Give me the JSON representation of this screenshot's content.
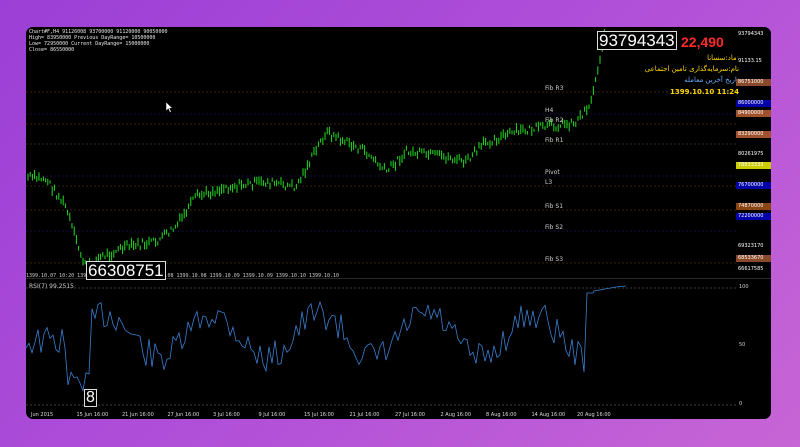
{
  "window": {
    "info_lines": [
      "Chart#F,H4  91126008 93700000 91120000 90050000",
      "High= 83950000 Previous DayRange= 10500000",
      "Low= 72950000 Current DayRange= 15000000",
      "Close= 86550000"
    ]
  },
  "price_readouts": {
    "high_box": "93794343",
    "low_box": "66308751",
    "rsi_box": "8",
    "change_value": "22,490"
  },
  "info_panel": {
    "line1": "نماد:سسانا",
    "line2": "نام:سرمایه‌گذاری تامین اجتماعی",
    "line3": "تاریخ آخرین معامله",
    "line4": "1399.10.10  11:24"
  },
  "levels": [
    {
      "label": "Fib R3"
    },
    {
      "label": "H4"
    },
    {
      "label": "Fib R2"
    },
    {
      "label": "Fib R1"
    },
    {
      "label": "Pivot"
    },
    {
      "label": "L3"
    },
    {
      "label": "Fib S1"
    },
    {
      "label": "Fib S2"
    },
    {
      "label": "Fib S3"
    }
  ],
  "price_axis": [
    {
      "text": "93794343",
      "bg": "#000000"
    },
    {
      "text": "91133.15",
      "bg": "#000000"
    },
    {
      "text": "86751000",
      "bg": "#8a4a2a"
    },
    {
      "text": "86000000",
      "bg": "#0000aa"
    },
    {
      "text": "84900000",
      "bg": "#a0522d"
    },
    {
      "text": "83290000",
      "bg": "#a0522d"
    },
    {
      "text": "80261975",
      "bg": "#000000"
    },
    {
      "text": "78833333",
      "bg": "#cccc00"
    },
    {
      "text": "76700000",
      "bg": "#0000aa"
    },
    {
      "text": "74870000",
      "bg": "#8b4513"
    },
    {
      "text": "72200000",
      "bg": "#0000aa"
    },
    {
      "text": "69323170",
      "bg": "#000000"
    },
    {
      "text": "68533670",
      "bg": "#8a4a2a"
    },
    {
      "text": "66617585",
      "bg": "#000000"
    }
  ],
  "rsi": {
    "label": "RSI(7) 99.2515",
    "axis_top": "100",
    "axis_mid": "50",
    "axis_bot": "0"
  },
  "date_row": "1399.10.07 10:20  1399.10.08  1399.10.07  1399.10.08  1399.10.08  1399.10.09  1399.10.09  1399.10.10  1399.10.10",
  "time_axis": [
    "Jun 2015",
    "15 Jun 16:00",
    "21 Jun 16:00",
    "27 Jun 16:00",
    "3 Jul 16:00",
    "9 Jul 16:00",
    "15 Jul 16:00",
    "21 Jul 16:00",
    "27 Jul 16:00",
    "2 Aug 16:00",
    "8 Aug 16:00",
    "14 Aug 16:00",
    "20 Aug 16:00"
  ],
  "colors": {
    "candle": "#22dd22",
    "rsi_line": "#3a7fd0",
    "accent_red": "#ff2a2a",
    "level_orange": "#b8860b"
  }
}
